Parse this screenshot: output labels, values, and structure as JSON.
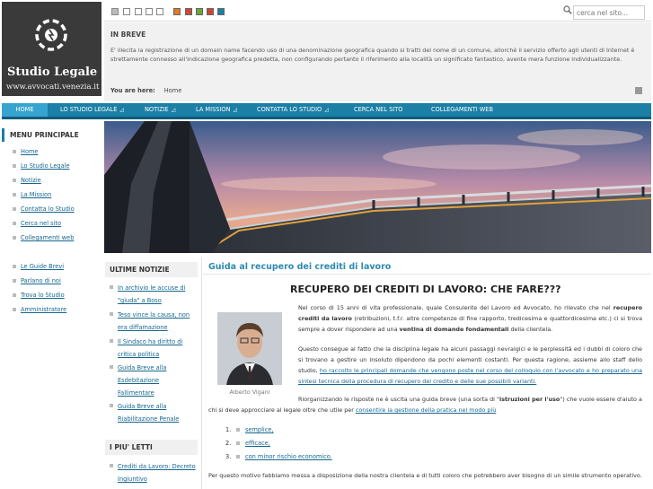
{
  "logo": {
    "name": "Studio Legale",
    "url": "www.avvocati.venezia.it"
  },
  "topbar": {
    "search_placeholder": "cerca nel sito...",
    "colors": [
      "#e07b2a",
      "#c94a36",
      "#69a73a",
      "#d24430",
      "#1b7fa6"
    ]
  },
  "inbreve": {
    "title": "IN BREVE",
    "text": "E' illecita la registrazione di un domain name facendo uso di una denominazione geografica quando si tratti del nome di un comune, allorché il servizio offerto agli utenti di Internet è strettamente connesso all'indicazione geografica predetta, non configurando pertanto il riferimento alla località un significato fantastico, avente mera funzione individualizzante.",
    "crumb_label": "You are here:",
    "crumb_value": "Home"
  },
  "nav": {
    "items": [
      "HOME",
      "LO STUDIO LEGALE",
      "NOTIZIE",
      "LA MISSION",
      "CONTATTA LO STUDIO",
      "CERCA NEL SITO",
      "COLLEGAMENTI WEB"
    ]
  },
  "sidebar": {
    "title": "MENU PRINCIPALE",
    "items": [
      "Home",
      "Lo Studio Legale",
      "Notizie",
      "La Mission",
      "Contatta lo Studio",
      "Cerca nel sito",
      "Collegamenti web"
    ],
    "items2": [
      "Le Guide Brevi",
      "Parlano di noi",
      "Trova lo Studio",
      "Amministratore"
    ]
  },
  "news": {
    "title": "ULTIME NOTIZIE",
    "items": [
      "In archivio le accuse di \"giuda\" a Boso",
      "Teso vince la causa, non era diffamazione",
      "Il Sindaco ha diritto di critica politica",
      "Guida Breve alla Esdebitazione Fallimentare",
      "Guida Breve alla Riabilitazione Penale"
    ]
  },
  "letti": {
    "title": "I PIU' LETTI",
    "items": [
      "Crediti da Lavoro: Decreto Ingiuntivo"
    ]
  },
  "article": {
    "title": "Guida al recupero dei crediti di lavoro",
    "heading": "RECUPERO DEI CREDITI DI LAVORO: CHE FARE???",
    "photo_caption": "Alberto Vigani",
    "p1_a": "Nel corso di 15 anni di vita professionale, quale Consulente del Lavoro ed Avvocato, ho rilevato che nel ",
    "p1_b": "recupero crediti da lavoro",
    "p1_c": " (retribuzioni, t.f.r. altre competenze di fine rapporto, tredicesima e quattordicesima etc.) ci si trova sempre a dover rispondere ad una ",
    "p1_d": "ventina di domande fondamentali",
    "p1_e": " della clientela.",
    "p2_a": "Questo consegue al fatto che la disciplina legale ha alcuni passaggi nevralgici e le perplessità ed i dubbi di coloro che si trovano a gestire un insoluto dipendono da pochi elementi costanti. Per questa ragione, assieme allo staff dello studio, ",
    "p2_b": "ho raccolto le principali domande che vengono poste nel corso del colloquio con l'avvocato e ho preparato una sintesi tecnica della procedura di recupero del credito e delle sue possibili varianti.",
    "p3_a": "Riorganizzando le risposte ne è uscita una guida breve (una sorta di \"",
    "p3_b": "istruzioni per l'uso",
    "p3_c": "\") che vuole essere d'aiuto a chi si deve approcciare al legale oltre che utile per ",
    "p3_d": "consentire la gestione della pratica nel modo più",
    "list": [
      {
        "num": "1.",
        "text": "semplice,"
      },
      {
        "num": "2.",
        "text": "efficace,"
      },
      {
        "num": "3.",
        "text": "con minor rischio economico."
      }
    ],
    "p4": "Per questo motivo fabbiamo messa a disposizione della nostra clientela e di tutti coloro che potrebbero aver bisogno di un simile strumento operativo."
  }
}
